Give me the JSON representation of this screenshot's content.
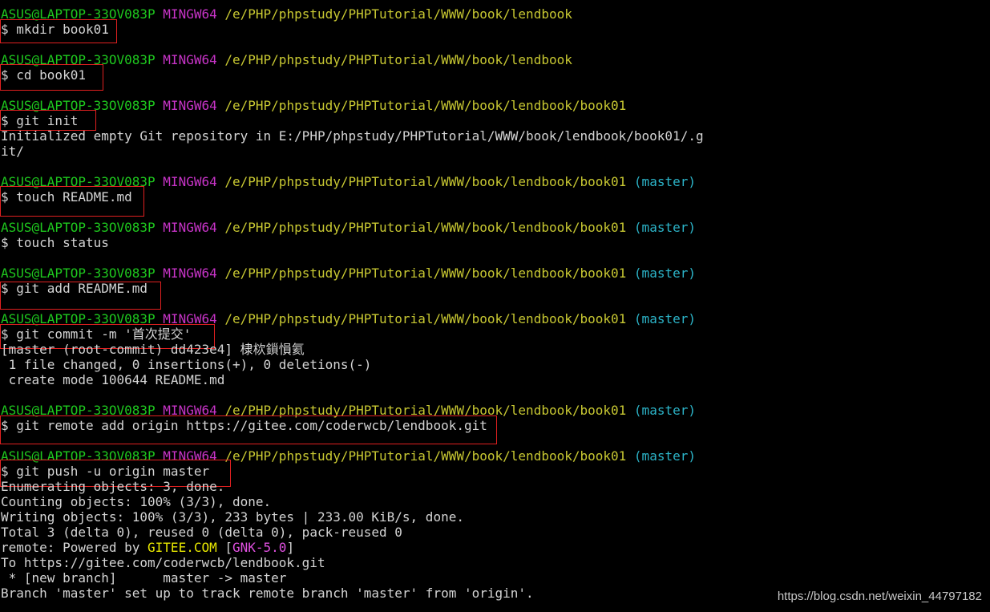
{
  "prompts": [
    {
      "user": "ASUS@LAPTOP-33OV083P",
      "system": "MINGW64",
      "path": "/e/PHP/phpstudy/PHPTutorial/WWW/book/lendbook",
      "branch": ""
    },
    {
      "user": "ASUS@LAPTOP-33OV083P",
      "system": "MINGW64",
      "path": "/e/PHP/phpstudy/PHPTutorial/WWW/book/lendbook",
      "branch": ""
    },
    {
      "user": "ASUS@LAPTOP-33OV083P",
      "system": "MINGW64",
      "path": "/e/PHP/phpstudy/PHPTutorial/WWW/book/lendbook/book01",
      "branch": ""
    },
    {
      "user": "ASUS@LAPTOP-33OV083P",
      "system": "MINGW64",
      "path": "/e/PHP/phpstudy/PHPTutorial/WWW/book/lendbook/book01",
      "branch": "(master)"
    },
    {
      "user": "ASUS@LAPTOP-33OV083P",
      "system": "MINGW64",
      "path": "/e/PHP/phpstudy/PHPTutorial/WWW/book/lendbook/book01",
      "branch": "(master)"
    },
    {
      "user": "ASUS@LAPTOP-33OV083P",
      "system": "MINGW64",
      "path": "/e/PHP/phpstudy/PHPTutorial/WWW/book/lendbook/book01",
      "branch": "(master)"
    },
    {
      "user": "ASUS@LAPTOP-33OV083P",
      "system": "MINGW64",
      "path": "/e/PHP/phpstudy/PHPTutorial/WWW/book/lendbook/book01",
      "branch": "(master)"
    },
    {
      "user": "ASUS@LAPTOP-33OV083P",
      "system": "MINGW64",
      "path": "/e/PHP/phpstudy/PHPTutorial/WWW/book/lendbook/book01",
      "branch": "(master)"
    },
    {
      "user": "ASUS@LAPTOP-33OV083P",
      "system": "MINGW64",
      "path": "/e/PHP/phpstudy/PHPTutorial/WWW/book/lendbook/book01",
      "branch": "(master)"
    }
  ],
  "commands": [
    "$ mkdir book01",
    "$ cd book01",
    "$ git init",
    "$ touch README.md",
    "$ touch status",
    "$ git add README.md",
    "$ git commit -m '首次提交'",
    "$ git remote add origin https://gitee.com/coderwcb/lendbook.git",
    "$ git push -u origin master"
  ],
  "outputs": {
    "init_1": "Initialized empty Git repository in E:/PHP/phpstudy/PHPTutorial/WWW/book/lendbook/book01/.g",
    "init_2": "it/",
    "commit_1": "[master (root-commit) dd423e4] 棣栨鎻愪氦",
    "commit_2": " 1 file changed, 0 insertions(+), 0 deletions(-)",
    "commit_3": " create mode 100644 README.md",
    "push_1": "Enumerating objects: 3, done.",
    "push_2": "Counting objects: 100% (3/3), done.",
    "push_3": "Writing objects: 100% (3/3), 233 bytes | 233.00 KiB/s, done.",
    "push_4": "Total 3 (delta 0), reused 0 (delta 0), pack-reused 0",
    "push_5_prefix": "remote: Powered by ",
    "push_5_gitee": "GITEE.COM",
    "push_5_open": " [",
    "push_5_gnk": "GNK-5.0",
    "push_5_close": "]",
    "push_6": "To https://gitee.com/coderwcb/lendbook.git",
    "push_7": " * [new branch]      master -> master",
    "push_8": "Branch 'master' set up to track remote branch 'master' from 'origin'."
  },
  "watermark": "https://blog.csdn.net/weixin_44797182",
  "colors": {
    "background": "#000000",
    "user": "#1ec81e",
    "system": "#c834c8",
    "path": "#c8c832",
    "branch": "#2cb4c8",
    "text": "#d4d4d4",
    "highlight_box": "#e02020"
  }
}
